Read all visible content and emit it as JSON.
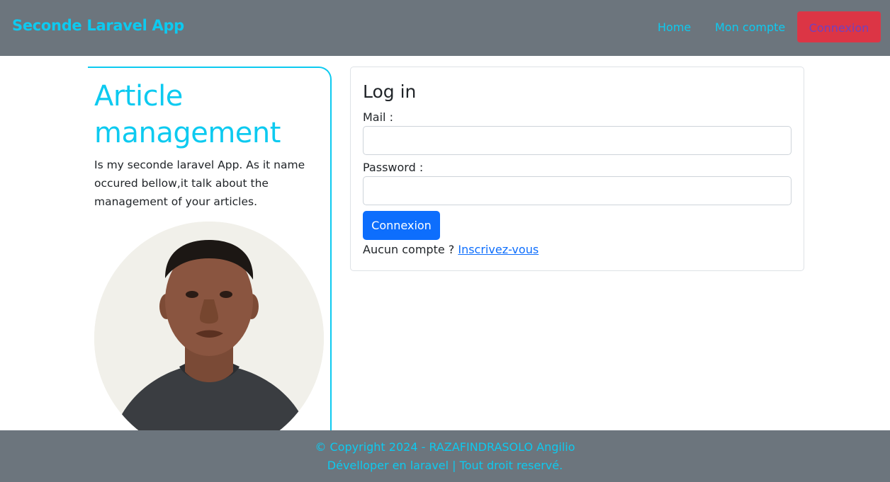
{
  "navbar": {
    "brand": "Seconde Laravel App",
    "links": [
      {
        "label": "Home"
      },
      {
        "label": "Mon compte"
      }
    ],
    "button_label": "Connexion",
    "colors": {
      "background": "#6c757d",
      "accent": "#0dcaf0",
      "button": "#dc3545"
    }
  },
  "hero": {
    "title": "Article management",
    "description": "Is my seconde laravel App. As it name occured bellow,it talk about the management of your articles.",
    "image_icon": "profile-photo"
  },
  "login": {
    "title": "Log in",
    "mail_label": "Mail :",
    "mail_value": "",
    "password_label": "Password :",
    "password_value": "",
    "submit_label": "Connexion",
    "signup_prompt": "Aucun compte ? ",
    "signup_link": "Inscrivez-vous",
    "colors": {
      "primary": "#0d6efd"
    }
  },
  "footer": {
    "line1": "© Copyright 2024 - RAZAFINDRASOLO Angilio",
    "line2": "Dévelloper en laravel | Tout droit reservé."
  }
}
